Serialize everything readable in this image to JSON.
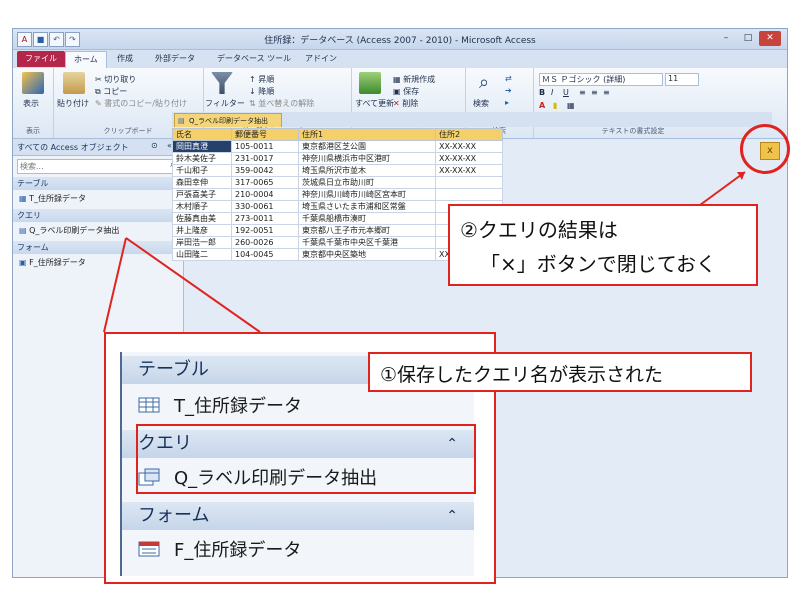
{
  "window": {
    "title": "住所録：データベース (Access 2007 - 2010) - Microsoft Access",
    "min_label": "–",
    "max_label": "□",
    "close_label": "✕"
  },
  "ribbon": {
    "tabs": [
      {
        "label": "ファイル"
      },
      {
        "label": "ホーム"
      },
      {
        "label": "作成"
      },
      {
        "label": "外部データ"
      },
      {
        "label": "データベース ツール"
      },
      {
        "label": "アドイン"
      }
    ],
    "groups": {
      "view": {
        "label": "表示",
        "button": "表示"
      },
      "clipboard": {
        "label": "クリップボード",
        "paste": "貼り付け",
        "cut": "切り取り",
        "copy": "コピー",
        "format_painter": "書式のコピー/貼り付け"
      },
      "sort": {
        "label": "並べ替えとフィルター",
        "filter": "フィルター",
        "ascending": "昇順",
        "descending": "降順",
        "clear": "並べ替えの解除"
      },
      "records": {
        "label": "レコード",
        "refresh": "すべて更新",
        "new": "新規作成",
        "save": "保存",
        "delete": "削除"
      },
      "find": {
        "label": "検索",
        "button": "検索"
      },
      "text": {
        "label": "テキストの書式設定",
        "font": "ＭＳ Ｐゴシック (詳細)",
        "size": "11"
      }
    }
  },
  "nav": {
    "header": "すべての Access オブジェクト",
    "search_placeholder": "検索...",
    "sections": [
      {
        "label": "テーブル",
        "items": [
          "T_住所録データ"
        ]
      },
      {
        "label": "クエリ",
        "items": [
          "Q_ラベル印刷データ抽出"
        ]
      },
      {
        "label": "フォーム",
        "items": [
          "F_住所録データ"
        ]
      }
    ]
  },
  "document": {
    "tab_label": "Q_ラベル印刷データ抽出",
    "close_label": "x",
    "columns": [
      "氏名",
      "郵便番号",
      "住所1",
      "住所2"
    ],
    "rows": [
      [
        "岡田真澄",
        "105-0011",
        "東京都港区芝公園",
        "XX-XX-XX"
      ],
      [
        "鈴木美佐子",
        "231-0017",
        "神奈川県横浜市中区港町",
        "XX-XX-XX"
      ],
      [
        "千山和子",
        "359-0042",
        "埼玉県所沢市並木",
        "XX-XX-XX"
      ],
      [
        "森田幸伸",
        "317-0065",
        "茨城県日立市助川町",
        ""
      ],
      [
        "戸張喜美子",
        "210-0004",
        "神奈川県川崎市川崎区宮本町",
        ""
      ],
      [
        "木村順子",
        "330-0061",
        "埼玉県さいたま市浦和区常盤",
        ""
      ],
      [
        "佐藤真由美",
        "273-0011",
        "千葉県船橋市湊町",
        ""
      ],
      [
        "井上隆彦",
        "192-0051",
        "東京都八王子市元本郷町",
        ""
      ],
      [
        "岸田浩一郎",
        "260-0026",
        "千葉県千葉市中央区千葉港",
        ""
      ],
      [
        "山田隆二",
        "104-0045",
        "東京都中央区築地",
        "XX-XX-XX"
      ]
    ]
  },
  "annotations": {
    "callout2_line1": "②クエリの結果は",
    "callout2_line2": "「×」ボタンで閉じておく",
    "callout1": "①保存したクエリ名が表示された"
  },
  "zoom": {
    "sections": [
      {
        "label": "テーブル",
        "item": "T_住所録データ"
      },
      {
        "label": "クエリ",
        "item": "Q_ラベル印刷データ抽出"
      },
      {
        "label": "フォーム",
        "item": "F_住所録データ"
      }
    ],
    "collapse_glyph": "⌃"
  },
  "colors": {
    "accent_red": "#e0231f",
    "file_tab": "#b5274a",
    "query_tab": "#f4d57a"
  }
}
